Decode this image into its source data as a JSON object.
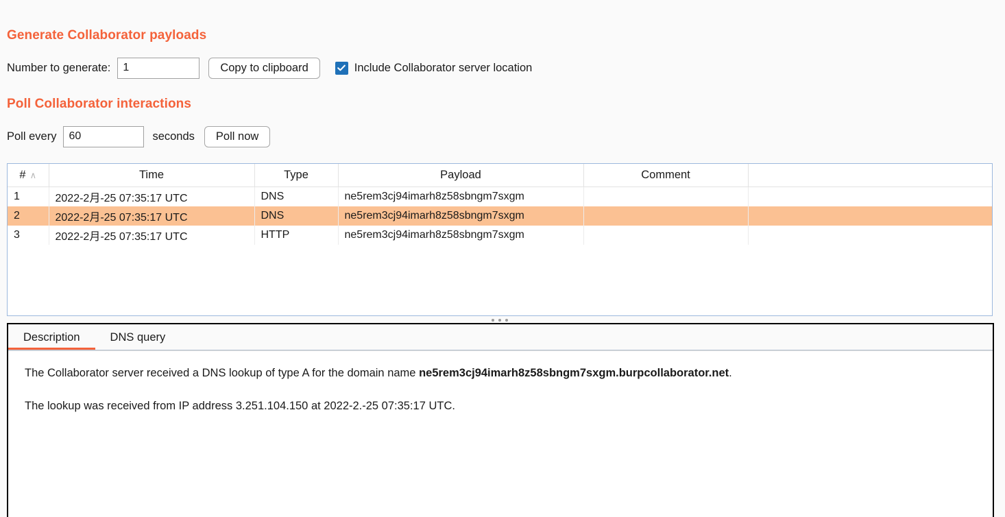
{
  "generate": {
    "title": "Generate Collaborator payloads",
    "number_label": "Number to generate:",
    "number_value": "1",
    "number_placeholder": "",
    "copy_button": "Copy to clipboard",
    "include_location_label": "Include Collaborator server location",
    "include_location_checked": true
  },
  "poll": {
    "title": "Poll Collaborator interactions",
    "every_label": "Poll every",
    "interval_value": "60",
    "interval_placeholder": "",
    "seconds_label": "seconds",
    "poll_now_button": "Poll now"
  },
  "table": {
    "columns": [
      "#",
      "Time",
      "Type",
      "Payload",
      "Comment",
      ""
    ],
    "sort_column": "#",
    "sort_direction": "ascending",
    "sort_caret": "∧",
    "selected_row_index": 1,
    "selected_row_color": "#fbc193",
    "rows": [
      {
        "num": "1",
        "time": "2022-2月-25 07:35:17 UTC",
        "type": "DNS",
        "payload": "ne5rem3cj94imarh8z58sbngm7sxgm",
        "comment": "",
        "extra": ""
      },
      {
        "num": "2",
        "time": "2022-2月-25 07:35:17 UTC",
        "type": "DNS",
        "payload": "ne5rem3cj94imarh8z58sbngm7sxgm",
        "comment": "",
        "extra": ""
      },
      {
        "num": "3",
        "time": "2022-2月-25 07:35:17 UTC",
        "type": "HTTP",
        "payload": "ne5rem3cj94imarh8z58sbngm7sxgm",
        "comment": "",
        "extra": ""
      }
    ]
  },
  "detail": {
    "tabs": [
      {
        "label": "Description",
        "active": true
      },
      {
        "label": "DNS query",
        "active": false
      }
    ],
    "paragraph1_prefix": "The Collaborator server received a DNS lookup of type A for the domain name ",
    "paragraph1_domain": "ne5rem3cj94imarh8z58sbngm7sxgm.burpcollaborator.net",
    "paragraph1_suffix": ".",
    "paragraph2": "The lookup was received from IP address 3.251.104.150 at 2022-2.-25 07:35:17 UTC."
  },
  "colors": {
    "accent": "#f4623a",
    "checkbox": "#1f71b8",
    "selection": "#fbc193",
    "table_border": "#9cb8dd",
    "background": "#fafafa"
  }
}
